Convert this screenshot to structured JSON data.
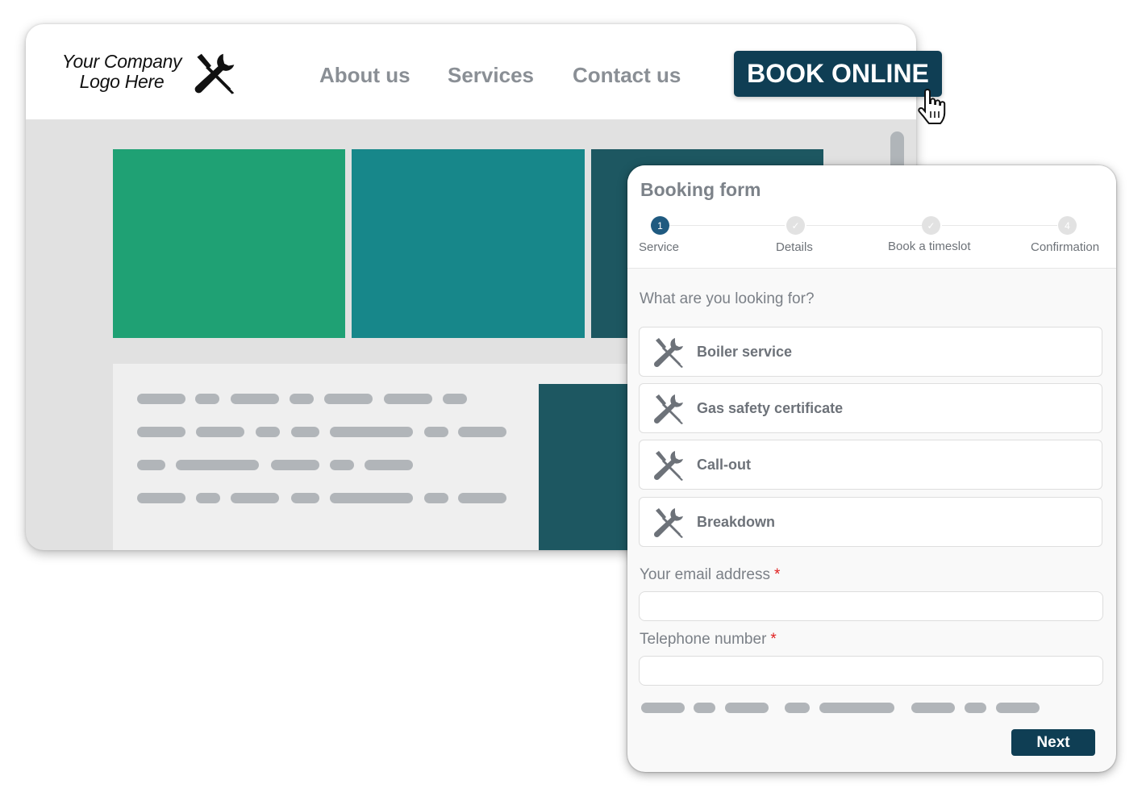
{
  "site": {
    "logo": {
      "line1": "Your Company",
      "line2": "Logo Here",
      "icon": "wrench-screwdriver-icon"
    },
    "nav": [
      {
        "label": "About us"
      },
      {
        "label": "Services"
      },
      {
        "label": "Contact us"
      }
    ],
    "cta_label": "BOOK ONLINE",
    "cursor_icon": "hand-pointer-icon",
    "colors": {
      "tile1": "#1fa174",
      "tile2": "#17878a",
      "tile3": "#1d5761",
      "cta": "#0f3e54"
    }
  },
  "booking_form": {
    "title": "Booking form",
    "steps": [
      {
        "label": "Service",
        "marker": "1",
        "state": "active"
      },
      {
        "label": "Details",
        "marker": "✓",
        "state": "done"
      },
      {
        "label": "Book a timeslot",
        "marker": "✓",
        "state": "done"
      },
      {
        "label": "Confirmation",
        "marker": "4",
        "state": "pending"
      }
    ],
    "question": "What are you looking for?",
    "options": [
      {
        "label": "Boiler service",
        "icon": "tools-icon"
      },
      {
        "label": "Gas safety certificate",
        "icon": "tools-icon"
      },
      {
        "label": "Call-out",
        "icon": "tools-icon"
      },
      {
        "label": "Breakdown",
        "icon": "tools-icon"
      }
    ],
    "email": {
      "label": "Your email address",
      "required_mark": "*",
      "value": "",
      "placeholder": ""
    },
    "phone": {
      "label": "Telephone number",
      "required_mark": "*",
      "value": "",
      "placeholder": ""
    },
    "next_label": "Next"
  }
}
